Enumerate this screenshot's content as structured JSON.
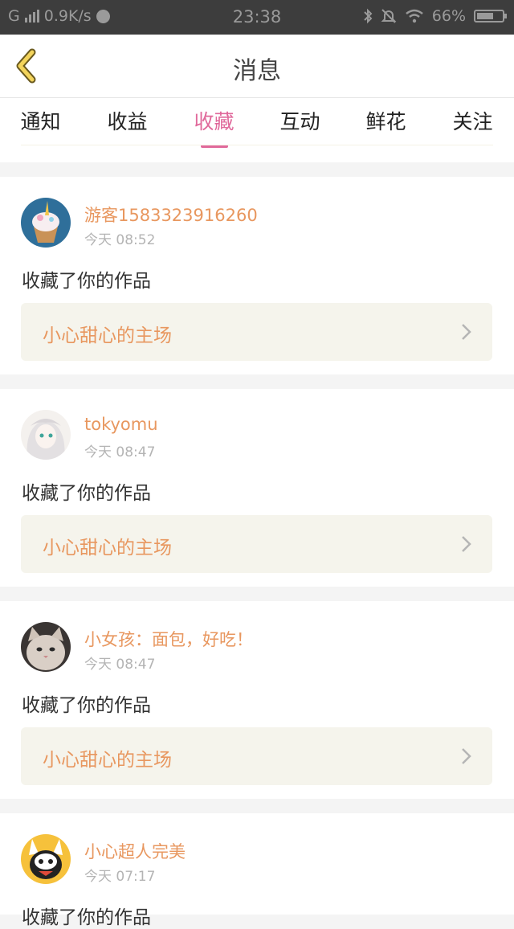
{
  "status_bar": {
    "network_type": "G",
    "speed": "0.9K/s",
    "time": "23:38",
    "battery": "66%",
    "battery_level": 0.66,
    "icons": [
      "signal-icon",
      "app-notify-icon",
      "bluetooth-icon",
      "mute-bell-icon",
      "wifi-icon",
      "battery-icon"
    ]
  },
  "header": {
    "title": "消息",
    "back_icon": "chevron-left-icon"
  },
  "tabs": [
    {
      "label": "通知",
      "active": false
    },
    {
      "label": "收益",
      "active": false
    },
    {
      "label": "收藏",
      "active": true
    },
    {
      "label": "互动",
      "active": false
    },
    {
      "label": "鲜花",
      "active": false
    },
    {
      "label": "关注",
      "active": false
    }
  ],
  "colors": {
    "accent_pink": "#e0699b",
    "username_orange": "#e8975f",
    "work_bg": "#f5f4ec"
  },
  "messages": [
    {
      "username": "游客1583323916260",
      "time": "今天 08:52",
      "action": "收藏了你的作品",
      "work_title": "小心甜心的主场",
      "avatar": "cupcake-avatar"
    },
    {
      "username": "tokyomu",
      "time": "今天 08:47",
      "action": "收藏了你的作品",
      "work_title": "小心甜心的主场",
      "avatar": "anime-girl-avatar"
    },
    {
      "username": "小女孩：面包，好吃！",
      "time": "今天 08:47",
      "action": "收藏了你的作品",
      "work_title": "小心甜心的主场",
      "avatar": "cat-avatar"
    },
    {
      "username": "小心超人完美",
      "time": "今天 07:17",
      "action": "收藏了你的作品",
      "work_title": "",
      "avatar": "cartoon-avatar"
    }
  ]
}
